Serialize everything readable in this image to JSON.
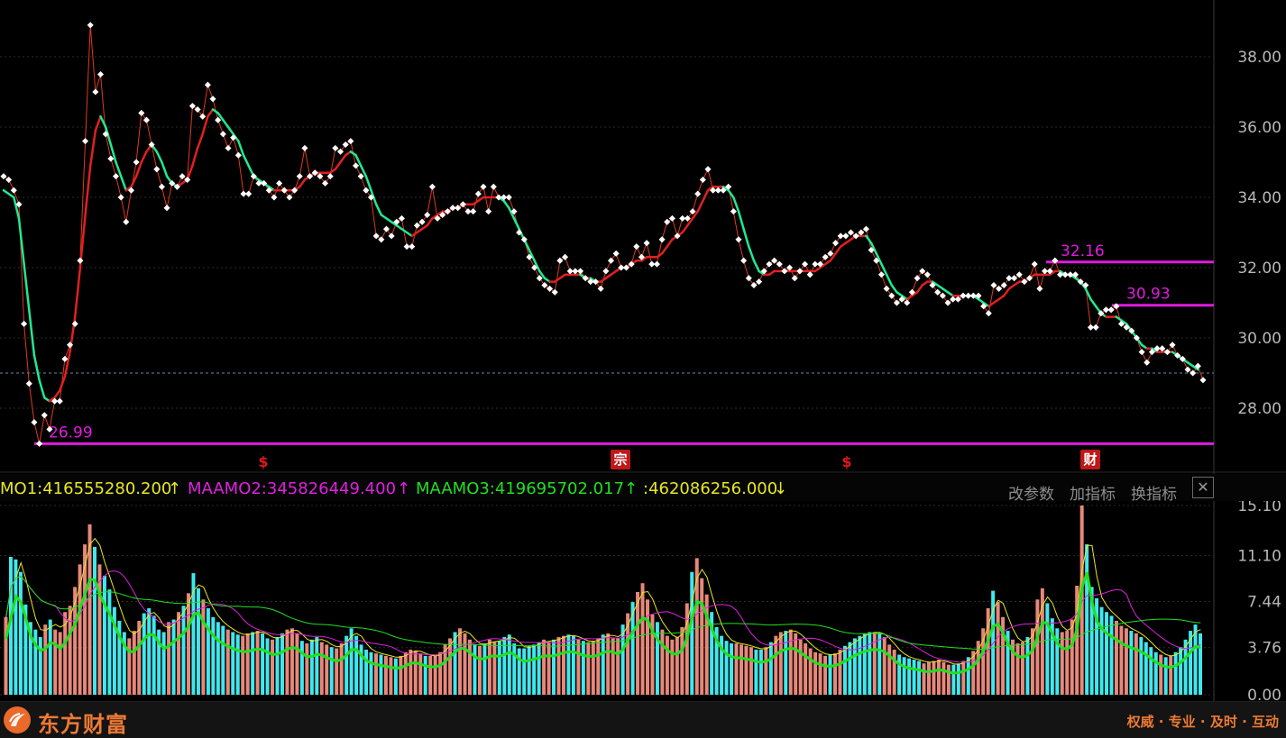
{
  "chart_data": [
    {
      "type": "line",
      "ylim": [
        27,
        39
      ],
      "yticks": [
        "38.00",
        "36.00",
        "34.00",
        "32.00",
        "30.00",
        "28.00"
      ],
      "tick_values": [
        38,
        36,
        34,
        32,
        30,
        28
      ],
      "close": [
        34.6,
        34.5,
        34.2,
        33.8,
        30.4,
        28.7,
        27.6,
        26.99,
        27.8,
        27.4,
        28.2,
        28.2,
        29.4,
        29.8,
        30.4,
        32.2,
        35.6,
        38.9,
        37.0,
        37.5,
        35.8,
        35.1,
        34.6,
        34.0,
        33.3,
        34.2,
        35.0,
        36.4,
        36.2,
        35.5,
        34.8,
        34.3,
        33.7,
        34.4,
        34.3,
        34.6,
        34.5,
        36.6,
        36.5,
        36.3,
        37.2,
        36.8,
        36.2,
        35.8,
        35.4,
        35.7,
        35.2,
        34.1,
        34.1,
        34.6,
        34.4,
        34.4,
        34.2,
        34.0,
        34.4,
        34.2,
        34.0,
        34.2,
        34.6,
        35.4,
        34.6,
        34.7,
        34.6,
        34.4,
        34.6,
        35.4,
        35.3,
        35.5,
        35.6,
        34.9,
        34.6,
        34.2,
        34.0,
        32.9,
        32.8,
        33.1,
        32.9,
        33.3,
        33.4,
        32.6,
        32.6,
        33.2,
        33.3,
        33.5,
        34.3,
        33.4,
        33.5,
        33.6,
        33.7,
        33.7,
        33.8,
        33.6,
        33.6,
        34.1,
        34.3,
        33.6,
        34.3,
        34.0,
        34.0,
        34.0,
        33.6,
        33.0,
        32.8,
        32.3,
        32.0,
        31.7,
        31.5,
        31.4,
        31.3,
        32.2,
        32.3,
        31.9,
        31.9,
        31.9,
        31.7,
        31.6,
        31.6,
        31.4,
        31.9,
        32.2,
        32.4,
        32.0,
        32.0,
        32.1,
        32.6,
        32.3,
        32.7,
        32.1,
        32.1,
        32.8,
        33.3,
        33.4,
        32.9,
        33.4,
        33.4,
        33.6,
        34.1,
        34.5,
        34.8,
        34.2,
        34.2,
        34.2,
        34.3,
        33.6,
        32.8,
        32.2,
        31.7,
        31.5,
        31.6,
        31.9,
        32.1,
        32.2,
        32.1,
        31.9,
        32.0,
        31.7,
        31.9,
        32.1,
        31.8,
        32.1,
        32.1,
        32.3,
        32.4,
        32.7,
        32.9,
        32.9,
        33.0,
        32.9,
        33.0,
        33.1,
        32.5,
        32.2,
        31.8,
        31.4,
        31.2,
        31.0,
        31.1,
        31.0,
        31.3,
        31.7,
        31.9,
        31.8,
        31.5,
        31.3,
        31.2,
        31.0,
        31.1,
        31.1,
        31.2,
        31.2,
        31.2,
        31.2,
        30.9,
        30.7,
        31.5,
        31.4,
        31.5,
        31.7,
        31.7,
        31.8,
        31.6,
        31.7,
        32.1,
        31.4,
        31.9,
        31.9,
        32.2,
        31.8,
        31.8,
        31.8,
        31.8,
        31.6,
        31.5,
        30.3,
        30.3,
        30.7,
        30.8,
        30.8,
        30.9,
        30.4,
        30.3,
        30.2,
        30.0,
        29.6,
        29.3,
        29.6,
        29.7,
        29.7,
        29.6,
        29.8,
        29.5,
        29.4,
        29.1,
        29.0,
        29.2,
        28.8
      ],
      "ma": [
        34.2,
        34.1,
        34.0,
        33.4,
        32.1,
        30.8,
        29.5,
        28.8,
        28.3,
        28.2,
        28.3,
        28.5,
        28.9,
        29.6,
        30.6,
        32.0,
        33.5,
        34.9,
        35.9,
        36.3,
        36.0,
        35.5,
        35.0,
        34.6,
        34.2,
        34.3,
        34.6,
        35.0,
        35.3,
        35.5,
        35.3,
        35.0,
        34.6,
        34.4,
        34.3,
        34.4,
        34.5,
        34.9,
        35.4,
        35.8,
        36.3,
        36.5,
        36.4,
        36.2,
        36.0,
        35.8,
        35.6,
        35.2,
        34.9,
        34.6,
        34.5,
        34.4,
        34.3,
        34.2,
        34.2,
        34.2,
        34.2,
        34.2,
        34.3,
        34.5,
        34.6,
        34.7,
        34.7,
        34.7,
        34.7,
        34.8,
        35.0,
        35.2,
        35.3,
        35.2,
        34.9,
        34.6,
        34.2,
        33.8,
        33.5,
        33.4,
        33.3,
        33.2,
        33.1,
        33.0,
        32.9,
        33.0,
        33.1,
        33.2,
        33.4,
        33.5,
        33.6,
        33.6,
        33.7,
        33.7,
        33.8,
        33.8,
        33.8,
        33.9,
        34.0,
        34.0,
        34.0,
        34.0,
        33.9,
        33.7,
        33.4,
        33.1,
        32.8,
        32.5,
        32.2,
        31.9,
        31.7,
        31.6,
        31.6,
        31.7,
        31.8,
        31.8,
        31.8,
        31.8,
        31.7,
        31.7,
        31.6,
        31.6,
        31.7,
        31.8,
        31.9,
        32.0,
        32.0,
        32.1,
        32.2,
        32.2,
        32.3,
        32.3,
        32.3,
        32.4,
        32.6,
        32.8,
        32.9,
        33.0,
        33.2,
        33.4,
        33.6,
        33.9,
        34.2,
        34.3,
        34.3,
        34.3,
        34.2,
        34.0,
        33.6,
        33.1,
        32.6,
        32.2,
        31.9,
        31.8,
        31.8,
        31.9,
        31.9,
        31.9,
        31.9,
        31.9,
        31.9,
        31.9,
        31.9,
        31.9,
        32.0,
        32.1,
        32.2,
        32.4,
        32.6,
        32.7,
        32.8,
        32.9,
        32.9,
        32.9,
        32.7,
        32.4,
        32.1,
        31.8,
        31.5,
        31.3,
        31.2,
        31.1,
        31.2,
        31.3,
        31.5,
        31.6,
        31.6,
        31.5,
        31.4,
        31.3,
        31.2,
        31.2,
        31.2,
        31.2,
        31.2,
        31.1,
        31.0,
        30.9,
        31.0,
        31.1,
        31.2,
        31.4,
        31.5,
        31.6,
        31.6,
        31.7,
        31.8,
        31.8,
        31.8,
        31.8,
        31.9,
        31.9,
        31.8,
        31.8,
        31.7,
        31.6,
        31.4,
        31.1,
        30.9,
        30.7,
        30.6,
        30.6,
        30.6,
        30.5,
        30.4,
        30.2,
        30.0,
        29.8,
        29.7,
        29.7,
        29.6,
        29.6,
        29.6,
        29.6,
        29.5,
        29.4,
        29.3,
        29.2,
        29.1
      ],
      "hlines": [
        {
          "label": "32.16",
          "value": 32.16
        },
        {
          "label": "30.93",
          "value": 30.93
        },
        {
          "label": "26.99",
          "value": 26.99
        }
      ],
      "current_price_line": 29.0,
      "colors": {
        "up_ma": "#e02020",
        "down_ma": "#20e890",
        "close": "#e03a1a",
        "dots": "#ffffff",
        "hline": "#e01be0",
        "dash": "#6b89b0"
      }
    },
    {
      "type": "bar",
      "ylim": [
        0,
        15.1
      ],
      "yticks": [
        "15.10",
        "11.10",
        "7.44",
        "3.76",
        "0.00"
      ],
      "tick_values": [
        15.1,
        11.1,
        7.44,
        3.76,
        0
      ],
      "volume": [
        6.2,
        11.0,
        10.8,
        9.8,
        7.2,
        5.8,
        5.2,
        4.6,
        5.6,
        6.0,
        5.2,
        5.0,
        6.6,
        7.1,
        8.6,
        10.4,
        12.0,
        13.6,
        11.8,
        10.4,
        9.5,
        8.4,
        7.0,
        5.9,
        5.0,
        4.5,
        5.1,
        5.9,
        6.5,
        6.9,
        6.3,
        5.2,
        5.0,
        5.8,
        6.0,
        6.6,
        7.1,
        8.1,
        9.7,
        8.5,
        7.6,
        6.9,
        6.2,
        5.8,
        5.5,
        5.2,
        5.0,
        4.8,
        4.7,
        4.9,
        5.0,
        5.1,
        4.9,
        4.5,
        4.4,
        4.6,
        4.9,
        5.2,
        5.3,
        4.9,
        4.3,
        4.1,
        4.4,
        4.6,
        4.2,
        4.0,
        3.8,
        3.7,
        4.1,
        4.7,
        5.3,
        4.7,
        4.0,
        3.6,
        3.4,
        3.3,
        3.2,
        3.1,
        3.0,
        2.9,
        3.1,
        3.4,
        3.6,
        3.5,
        3.3,
        3.1,
        3.1,
        3.1,
        3.4,
        4.0,
        4.5,
        5.0,
        5.3,
        4.9,
        4.4,
        4.0,
        3.9,
        4.1,
        4.4,
        4.2,
        4.3,
        4.6,
        4.8,
        4.1,
        3.7,
        3.7,
        3.9,
        4.0,
        4.2,
        4.4,
        4.2,
        4.4,
        4.6,
        4.7,
        4.8,
        4.7,
        4.4,
        4.3,
        4.2,
        4.3,
        4.5,
        4.8,
        4.9,
        4.5,
        4.5,
        5.6,
        6.5,
        7.4,
        8.2,
        8.9,
        7.6,
        6.4,
        5.8,
        5.2,
        4.7,
        4.4,
        4.6,
        5.4,
        7.3,
        9.8,
        10.9,
        9.3,
        8.0,
        6.6,
        5.4,
        4.7,
        4.3,
        4.1,
        4.1,
        4.0,
        3.9,
        3.8,
        3.6,
        3.6,
        3.8,
        4.2,
        4.7,
        5.0,
        5.1,
        5.2,
        4.9,
        4.4,
        4.1,
        3.7,
        3.4,
        3.3,
        3.1,
        3.2,
        3.3,
        3.6,
        3.9,
        4.2,
        4.5,
        4.7,
        4.9,
        5.0,
        5.0,
        4.9,
        4.6,
        4.0,
        3.6,
        3.2,
        3.0,
        2.9,
        2.8,
        2.7,
        2.5,
        2.6,
        2.7,
        2.8,
        2.6,
        2.4,
        2.4,
        2.5,
        2.7,
        3.0,
        3.5,
        4.3,
        5.3,
        6.9,
        8.3,
        7.4,
        6.2,
        5.1,
        4.4,
        4.1,
        4.2,
        4.6,
        5.3,
        7.6,
        8.5,
        7.3,
        6.1,
        5.3,
        5.0,
        5.1,
        6.0,
        8.7,
        15.1,
        12.0,
        8.6,
        7.7,
        7.0,
        6.6,
        6.3,
        5.9,
        5.5,
        5.3,
        5.1,
        4.9,
        4.6,
        4.2,
        3.8,
        3.4,
        3.2,
        3.0,
        3.1,
        3.4,
        3.8,
        4.4,
        5.1,
        5.6,
        4.9
      ],
      "vol_colors": {
        "up": "#e8887a",
        "down": "#40e8ee"
      },
      "ma_colors": {
        "ma1": "#e8e820",
        "ma2": "#e020e0",
        "ma3": "#20e020"
      }
    }
  ],
  "indicator_bar": {
    "ma1": "MO1:416555280.200",
    "ma1_arrow": "↑",
    "ma2": "MAAMO2:345826449.400",
    "ma2_arrow": "↑",
    "ma3": "MAAMO3:419695702.017",
    "ma3_arrow": "↑",
    "ma4": ":462086256.000",
    "ma4_arrow": "↓",
    "btn_params": "改参数",
    "btn_add": "加指标",
    "btn_switch": "换指标",
    "btn_close": "✕"
  },
  "markers": [
    {
      "text": "$",
      "kind": "s"
    },
    {
      "text": "宗",
      "kind": "box"
    },
    {
      "text": "$",
      "kind": "s"
    },
    {
      "text": "财",
      "kind": "box"
    }
  ],
  "footer": {
    "brand": "东方财富",
    "slogan": "权威 · 专业 · 及时 · 互动"
  }
}
